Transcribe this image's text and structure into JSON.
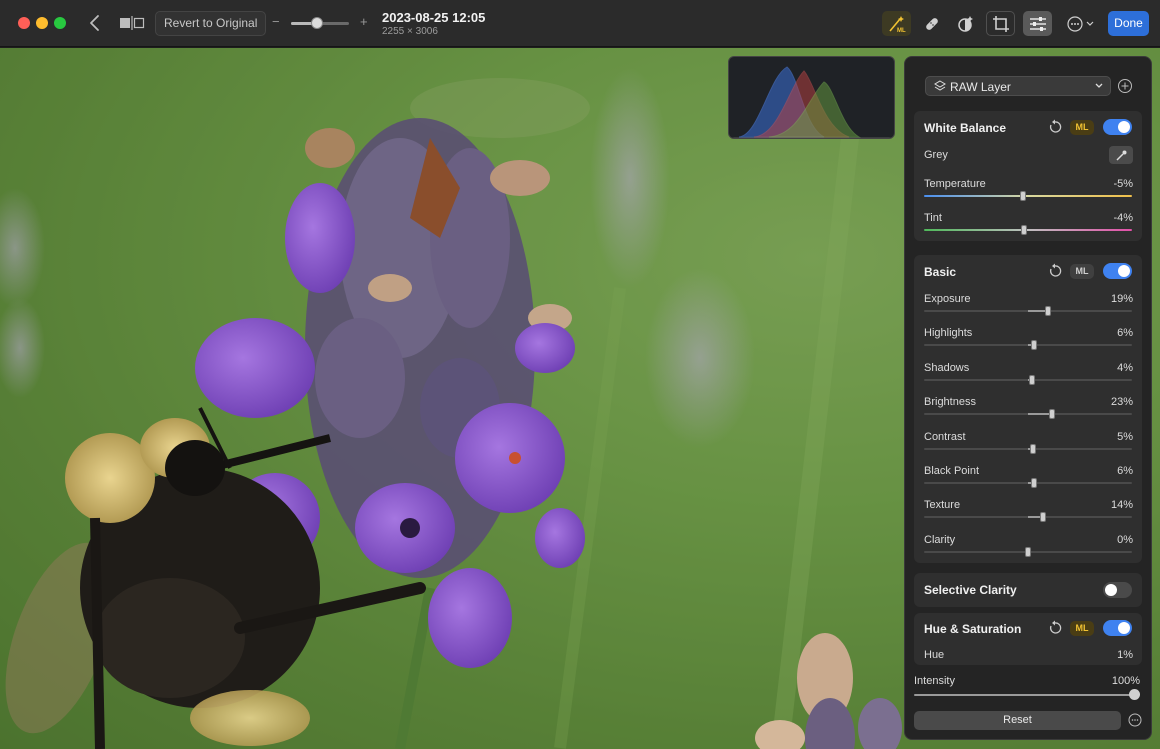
{
  "titlebar": {
    "revert_label": "Revert to Original",
    "zoom_minus": "−",
    "zoom_plus": "+",
    "zoom_level": 0.45,
    "document_title": "2023-08-25 12:05",
    "document_dimensions": "2255 × 3006",
    "done_label": "Done",
    "tools": [
      "ml-enhance-icon",
      "retouch-bandage-icon",
      "mask-icon",
      "crop-icon",
      "adjust-sliders-icon",
      "more-icon"
    ]
  },
  "panel": {
    "layer_label": "RAW Layer",
    "ml_badge": "ML",
    "white_balance": {
      "title": "White Balance",
      "enabled": true,
      "grey_label": "Grey",
      "rows": [
        {
          "label": "Temperature",
          "value": "-5%",
          "level": -0.05
        },
        {
          "label": "Tint",
          "value": "-4%",
          "level": -0.04
        }
      ]
    },
    "basic": {
      "title": "Basic",
      "enabled": true,
      "rows": [
        {
          "label": "Exposure",
          "value": "19%",
          "level": 0.19
        },
        {
          "label": "Highlights",
          "value": "6%",
          "level": 0.06
        },
        {
          "label": "Shadows",
          "value": "4%",
          "level": 0.04
        },
        {
          "label": "Brightness",
          "value": "23%",
          "level": 0.23
        },
        {
          "label": "Contrast",
          "value": "5%",
          "level": 0.05
        },
        {
          "label": "Black Point",
          "value": "6%",
          "level": 0.06
        },
        {
          "label": "Texture",
          "value": "14%",
          "level": 0.14
        },
        {
          "label": "Clarity",
          "value": "0%",
          "level": 0.0
        }
      ]
    },
    "selective_clarity": {
      "title": "Selective Clarity",
      "enabled": false
    },
    "hue_saturation": {
      "title": "Hue & Saturation",
      "enabled": true,
      "rows": [
        {
          "label": "Hue",
          "value": "1%",
          "level": 0.01
        }
      ]
    },
    "intensity": {
      "label": "Intensity",
      "value": "100%",
      "level": 1.0
    },
    "reset_label": "Reset"
  },
  "colors": {
    "accent": "#3f82f0",
    "done": "#2d6fd9",
    "ml": "#f1c232"
  }
}
